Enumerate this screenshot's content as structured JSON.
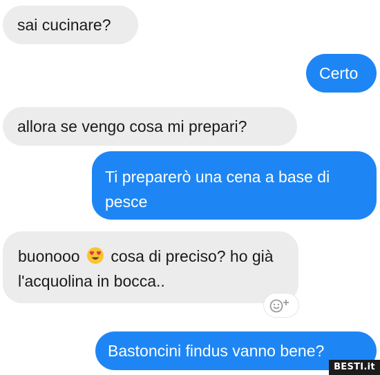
{
  "messages": [
    {
      "direction": "incoming",
      "text": "sai cucinare?"
    },
    {
      "direction": "outgoing",
      "text": "Certo"
    },
    {
      "direction": "incoming",
      "text": "allora se vengo cosa mi prepari?"
    },
    {
      "direction": "outgoing",
      "text": "Ti preparerò una cena a base di pesce"
    },
    {
      "direction": "incoming",
      "text_before": "buonooo",
      "emoji": "heart-eyes-emoji",
      "text_after": "cosa di preciso? ho già l'acquolina in bocca.."
    },
    {
      "direction": "outgoing",
      "text": "Bastoncini findus vanno bene?"
    }
  ],
  "reaction_button_icon": "add-reaction-icon",
  "watermark": "BESTI.it",
  "colors": {
    "outgoing_bubble": "#1e86f4",
    "incoming_bubble": "#ececec"
  }
}
